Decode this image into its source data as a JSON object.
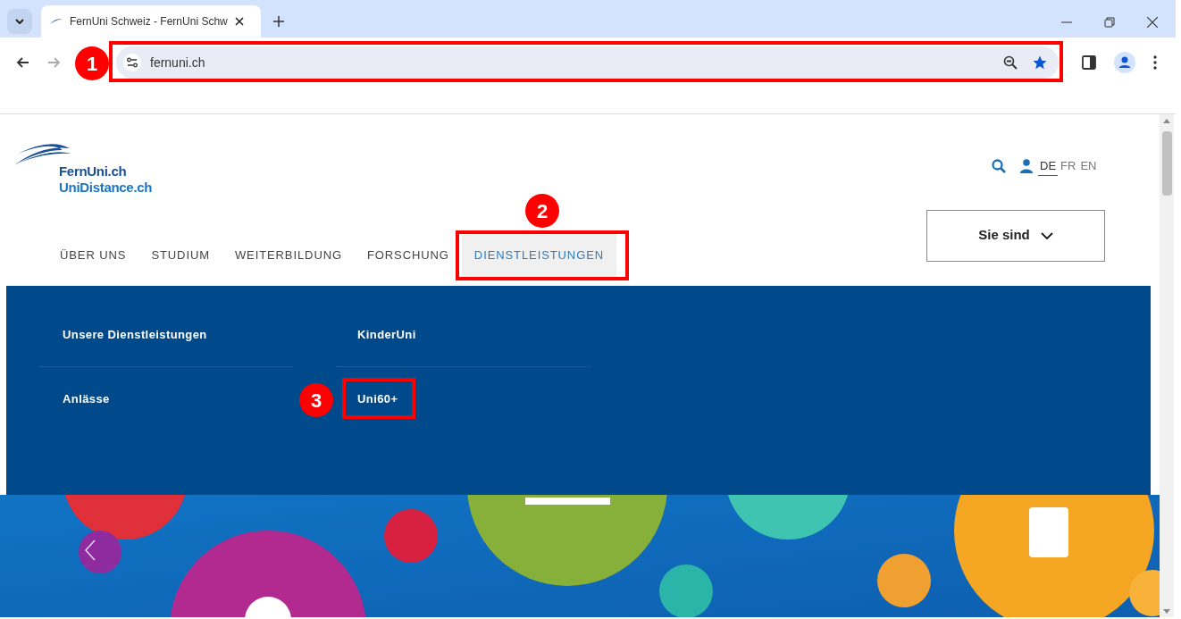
{
  "window": {
    "tab_title": "FernUni Schweiz - FernUni Schw",
    "address": "fernuni.ch",
    "bookmarked": true
  },
  "site": {
    "logo_lines": [
      "FernUni.ch",
      "UniDistance.ch"
    ],
    "languages": [
      {
        "label": "DE",
        "selected": true
      },
      {
        "label": "FR",
        "selected": false
      },
      {
        "label": "EN",
        "selected": false
      }
    ],
    "audience_button": "Sie sind",
    "nav": [
      {
        "label": "ÜBER UNS",
        "selected": false
      },
      {
        "label": "STUDIUM",
        "selected": false
      },
      {
        "label": "WEITERBILDUNG",
        "selected": false
      },
      {
        "label": "FORSCHUNG",
        "selected": false
      },
      {
        "label": "DIENSTLEISTUNGEN",
        "selected": true
      }
    ],
    "mega_menu": [
      {
        "label": "Unsere Dienstleistungen"
      },
      {
        "label": "KinderUni"
      },
      {
        "label": "Anlässe"
      },
      {
        "label": "Uni60+"
      }
    ],
    "hero": {
      "kind": "picture"
    }
  },
  "annotations": [
    {
      "number": "1"
    },
    {
      "number": "2"
    },
    {
      "number": "3"
    }
  ]
}
